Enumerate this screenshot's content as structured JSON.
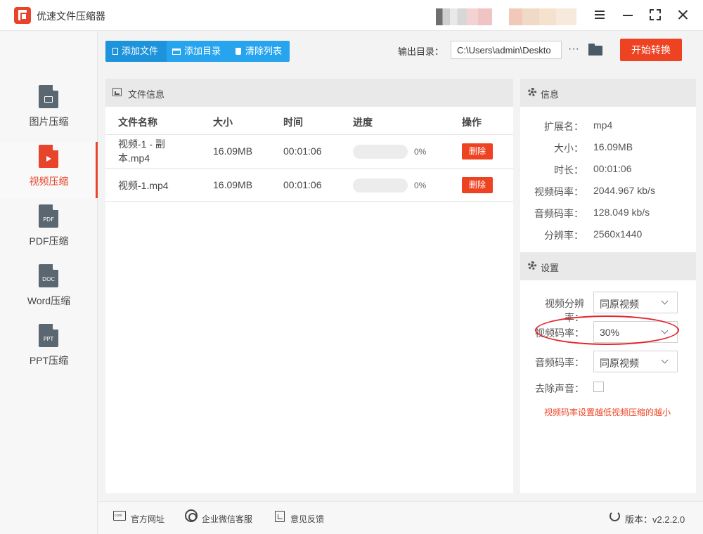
{
  "app": {
    "title": "优速文件压缩器"
  },
  "sidebar": {
    "items": [
      {
        "label": "图片压缩",
        "icon": "image-doc-icon",
        "active": false
      },
      {
        "label": "视频压缩",
        "icon": "video-doc-icon",
        "active": true
      },
      {
        "label": "PDF压缩",
        "icon": "pdf-doc-icon",
        "mark": "PDF",
        "active": false
      },
      {
        "label": "Word压缩",
        "icon": "doc-doc-icon",
        "mark": "DOC",
        "active": false
      },
      {
        "label": "PPT压缩",
        "icon": "ppt-doc-icon",
        "mark": "PPT",
        "active": false
      }
    ]
  },
  "toolbar": {
    "add_file": "添加文件",
    "add_dir": "添加目录",
    "clear_list": "清除列表",
    "output_label": "输出目录：",
    "output_value": "C:\\Users\\admin\\Deskto",
    "dots": "···",
    "start": "开始转换"
  },
  "file_panel": {
    "title": "文件信息",
    "columns": [
      "文件名称",
      "大小",
      "时间",
      "进度",
      "操作"
    ],
    "rows": [
      {
        "name": "视频-1 - 副本.mp4",
        "size": "16.09MB",
        "time": "00:01:06",
        "progress": 0,
        "progress_text": "0%",
        "action": "删除"
      },
      {
        "name": "视频-1.mp4",
        "size": "16.09MB",
        "time": "00:01:06",
        "progress": 0,
        "progress_text": "0%",
        "action": "删除"
      }
    ]
  },
  "info": {
    "title": "信息",
    "fields": [
      {
        "key": "扩展名：",
        "value": "mp4"
      },
      {
        "key": "大小：",
        "value": "16.09MB"
      },
      {
        "key": "时长：",
        "value": "00:01:06"
      },
      {
        "key": "视频码率：",
        "value": "2044.967 kb/s"
      },
      {
        "key": "音频码率：",
        "value": "128.049 kb/s"
      },
      {
        "key": "分辨率：",
        "value": "2560x1440"
      }
    ]
  },
  "settings": {
    "title": "设置",
    "video_resolution_label": "视频分辨率：",
    "video_resolution_value": "同原视频",
    "video_bitrate_label": "视频码率：",
    "video_bitrate_value": "30%",
    "audio_bitrate_label": "音频码率：",
    "audio_bitrate_value": "同原视频",
    "remove_audio_label": "去除声音：",
    "remove_audio_checked": false,
    "hint": "视频码率设置越低视频压缩的越小"
  },
  "footer": {
    "website": "官方网址",
    "wechat": "企业微信客服",
    "feedback": "意见反馈",
    "version_label": "版本：v2.2.2.0"
  },
  "colors": {
    "accent_blue": "#27a4ee",
    "accent_red": "#ee4322",
    "annotation": "#e4232a"
  }
}
